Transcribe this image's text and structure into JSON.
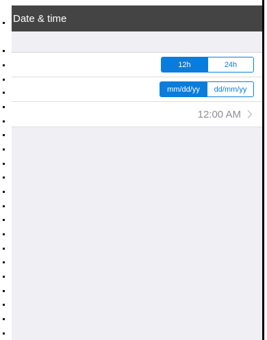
{
  "header": {
    "title": "Date & time"
  },
  "clock_format": {
    "options": [
      "12h",
      "24h"
    ],
    "selected": "12h"
  },
  "date_format": {
    "options": [
      "mm/dd/yy",
      "dd/mm/yy"
    ],
    "selected": "mm/dd/yy"
  },
  "time_row": {
    "value": "12:00 AM",
    "icon": "chevron-right-icon"
  },
  "colors": {
    "header_bg": "#444444",
    "accent": "#0a7ddc",
    "content_bg": "#efeff4",
    "secondary_text": "#8e8e93"
  }
}
